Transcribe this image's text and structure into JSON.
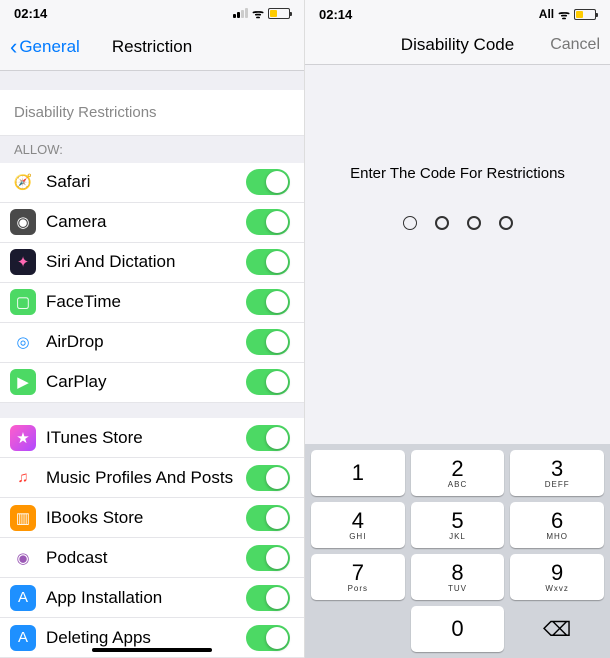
{
  "left": {
    "status_time": "02:14",
    "nav_back": "General",
    "nav_title": "Restriction",
    "disability_link": "Disability Restrictions",
    "allow_header": "ALLOW:",
    "group1": [
      {
        "icon_bg": "#fff",
        "icon_fg": "#1e90ff",
        "glyph": "🧭",
        "label": "Safari"
      },
      {
        "icon_bg": "#4a4a4a",
        "icon_fg": "#fff",
        "glyph": "◉",
        "label": "Camera"
      },
      {
        "icon_bg": "#1a1a2e",
        "icon_fg": "#ff69b4",
        "glyph": "✦",
        "label": "Siri And Dictation"
      },
      {
        "icon_bg": "#4cd964",
        "icon_fg": "#fff",
        "glyph": "▢",
        "label": "FaceTime"
      },
      {
        "icon_bg": "#fff",
        "icon_fg": "#1e90ff",
        "glyph": "◎",
        "label": "AirDrop"
      },
      {
        "icon_bg": "#4cd964",
        "icon_fg": "#fff",
        "glyph": "▶",
        "label": "CarPlay"
      }
    ],
    "group2": [
      {
        "icon_bg": "linear-gradient(135deg,#ff5ecb,#b049ff)",
        "icon_fg": "#fff",
        "glyph": "★",
        "label": "ITunes Store"
      },
      {
        "icon_bg": "#fff",
        "icon_fg": "#ff3b30",
        "glyph": "♫",
        "label": "Music Profiles And Posts"
      },
      {
        "icon_bg": "#ff9500",
        "icon_fg": "#fff",
        "glyph": "▥",
        "label": "IBooks Store"
      },
      {
        "icon_bg": "#fff",
        "icon_fg": "#9b59b6",
        "glyph": "◉",
        "label": "Podcast"
      },
      {
        "icon_bg": "#1e90ff",
        "icon_fg": "#fff",
        "glyph": "A",
        "label": "App Installation"
      },
      {
        "icon_bg": "#1e90ff",
        "icon_fg": "#fff",
        "glyph": "A",
        "label": "Deleting Apps"
      }
    ]
  },
  "right": {
    "status_time": "02:14",
    "status_carrier": "All",
    "nav_title": "Disability Code",
    "nav_cancel": "Cancel",
    "prompt": "Enter The Code For Restrictions",
    "keys": [
      {
        "num": "1",
        "sub": ""
      },
      {
        "num": "2",
        "sub": "ABC"
      },
      {
        "num": "3",
        "sub": "DEFF"
      },
      {
        "num": "4",
        "sub": "GHI"
      },
      {
        "num": "5",
        "sub": "JKL"
      },
      {
        "num": "6",
        "sub": "MHO"
      },
      {
        "num": "7",
        "sub": "Pors"
      },
      {
        "num": "8",
        "sub": "TUV"
      },
      {
        "num": "9",
        "sub": "Wxvz"
      }
    ],
    "key_zero": "0",
    "key_delete": "⌫"
  }
}
